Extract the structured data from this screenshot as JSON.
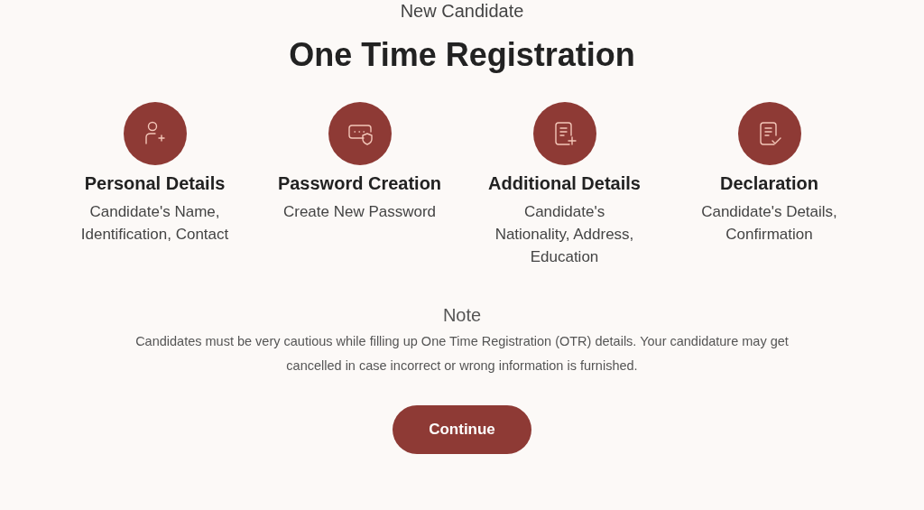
{
  "subtitle": "New Candidate",
  "title": "One Time Registration",
  "steps": [
    {
      "kind": "person",
      "title": "Personal Details",
      "description_lines": [
        "Candidate's Name,",
        "Identification, Contact"
      ]
    },
    {
      "kind": "password",
      "title": "Password Creation",
      "description_lines": [
        "Create New Password"
      ]
    },
    {
      "kind": "document_add",
      "title": "Additional Details",
      "description_lines": [
        "Candidate's",
        "Nationality, Address,",
        "Education"
      ]
    },
    {
      "kind": "document_check",
      "title": "Declaration",
      "description_lines": [
        "Candidate's Details,",
        "Confirmation"
      ]
    }
  ],
  "note": {
    "heading": "Note",
    "text": "Candidates must be very cautious while filling up One Time Registration (OTR) details. Your candidature may get cancelled in case incorrect or wrong information is furnished."
  },
  "button": "Continue"
}
